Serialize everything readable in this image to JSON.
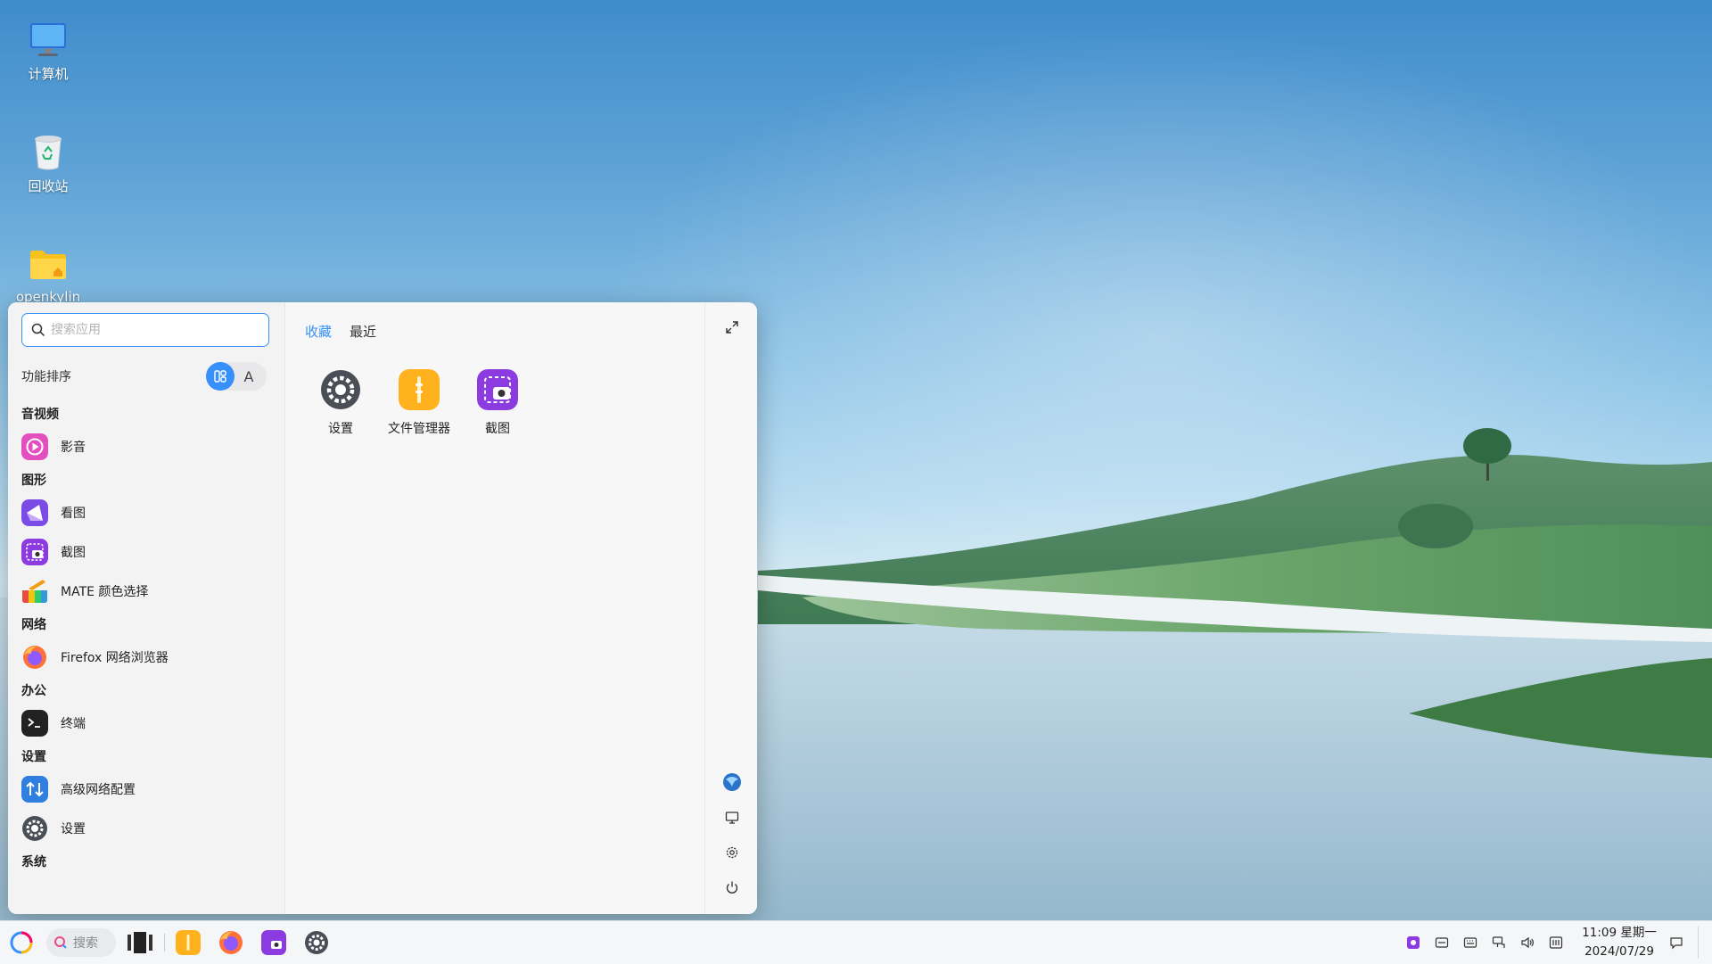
{
  "desktop": {
    "icons": [
      {
        "label": "计算机",
        "icon": "computer-icon"
      },
      {
        "label": "回收站",
        "icon": "trash-icon"
      },
      {
        "label": "openkylin",
        "icon": "home-folder-icon"
      }
    ]
  },
  "start_menu": {
    "search": {
      "placeholder": "搜索应用"
    },
    "sort": {
      "label": "功能排序",
      "options": [
        "category-icon",
        "A"
      ],
      "active": "category-icon"
    },
    "categories": [
      {
        "name": "音视频",
        "apps": [
          {
            "name": "影音",
            "icon": "video-player-icon"
          }
        ]
      },
      {
        "name": "图形",
        "apps": [
          {
            "name": "看图",
            "icon": "image-viewer-icon"
          },
          {
            "name": "截图",
            "icon": "screenshot-icon"
          },
          {
            "name": "MATE 颜色选择",
            "icon": "color-picker-icon"
          }
        ]
      },
      {
        "name": "网络",
        "apps": [
          {
            "name": "Firefox 网络浏览器",
            "icon": "firefox-icon"
          }
        ]
      },
      {
        "name": "办公",
        "apps": [
          {
            "name": "终端",
            "icon": "terminal-icon"
          }
        ]
      },
      {
        "name": "设置",
        "apps": [
          {
            "name": "高级网络配置",
            "icon": "network-config-icon"
          },
          {
            "name": "设置",
            "icon": "settings-icon"
          }
        ]
      },
      {
        "name": "系统",
        "apps": []
      }
    ],
    "tabs": [
      {
        "label": "收藏",
        "active": true
      },
      {
        "label": "最近",
        "active": false
      }
    ],
    "favorites": [
      {
        "name": "设置",
        "icon": "settings-icon"
      },
      {
        "name": "文件管理器",
        "icon": "file-manager-icon"
      },
      {
        "name": "截图",
        "icon": "screenshot-icon"
      }
    ],
    "side_buttons": [
      "expand-icon",
      "user-avatar-icon",
      "display-icon",
      "settings-gear-icon",
      "power-icon"
    ]
  },
  "taskbar": {
    "search_label": "搜索",
    "pinned": [
      "start-menu-icon",
      "multitask-view-icon",
      "file-manager-icon",
      "firefox-icon",
      "screenshot-icon",
      "settings-icon"
    ],
    "tray": [
      "screenshot-tray-icon",
      "input-method-icon",
      "keyboard-icon",
      "network-icon",
      "volume-icon",
      "sidebar-icon"
    ],
    "clock": {
      "time": "11:09 星期一",
      "date": "2024/07/29"
    }
  },
  "colors": {
    "accent": "#3790fa",
    "taskbar_bg": "#f4f6f8",
    "menu_bg": "#f5f5f6"
  }
}
